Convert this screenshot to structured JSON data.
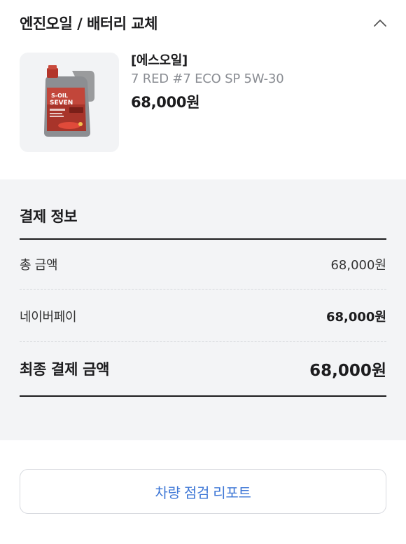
{
  "section": {
    "title": "엔진오일 / 배터리 교체"
  },
  "product": {
    "brand": "[에스오일]",
    "name": "7 RED #7 ECO SP 5W-30",
    "price": "68,000원",
    "image_icon": "oil-bottle-icon",
    "image_text": [
      "S-OIL",
      "SEVEN"
    ]
  },
  "payment": {
    "title": "결제 정보",
    "rows": [
      {
        "label": "총 금액",
        "value": "68,000원"
      },
      {
        "label": "네이버페이",
        "value": "68,000원"
      }
    ],
    "total": {
      "label": "최종 결제 금액",
      "value": "68,000원"
    }
  },
  "report_button": {
    "label": "차량 점검 리포트"
  },
  "colors": {
    "accent": "#3e77d6",
    "gray_bg": "#f3f4f6",
    "muted_text": "#8a8d93",
    "bottle_red": "#b7372b"
  }
}
